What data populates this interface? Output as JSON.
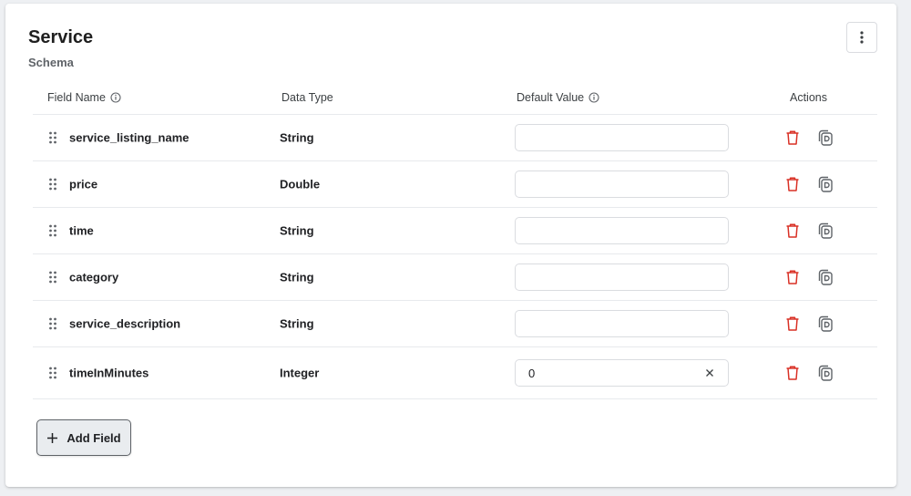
{
  "header": {
    "title": "Service",
    "subtitle": "Schema",
    "more_icon": "more-vert-icon"
  },
  "table": {
    "columns": {
      "field_name": "Field Name",
      "data_type": "Data Type",
      "default_value": "Default Value",
      "actions": "Actions"
    },
    "rows": [
      {
        "field_name": "service_listing_name",
        "data_type": "String",
        "default_value": ""
      },
      {
        "field_name": "price",
        "data_type": "Double",
        "default_value": ""
      },
      {
        "field_name": "time",
        "data_type": "String",
        "default_value": ""
      },
      {
        "field_name": "category",
        "data_type": "String",
        "default_value": ""
      },
      {
        "field_name": "service_description",
        "data_type": "String",
        "default_value": ""
      },
      {
        "field_name": "timeInMinutes",
        "data_type": "Integer",
        "default_value": "0"
      }
    ]
  },
  "footer": {
    "add_field_label": "Add Field"
  },
  "colors": {
    "delete": "#d93025",
    "icon": "#5f6368"
  }
}
